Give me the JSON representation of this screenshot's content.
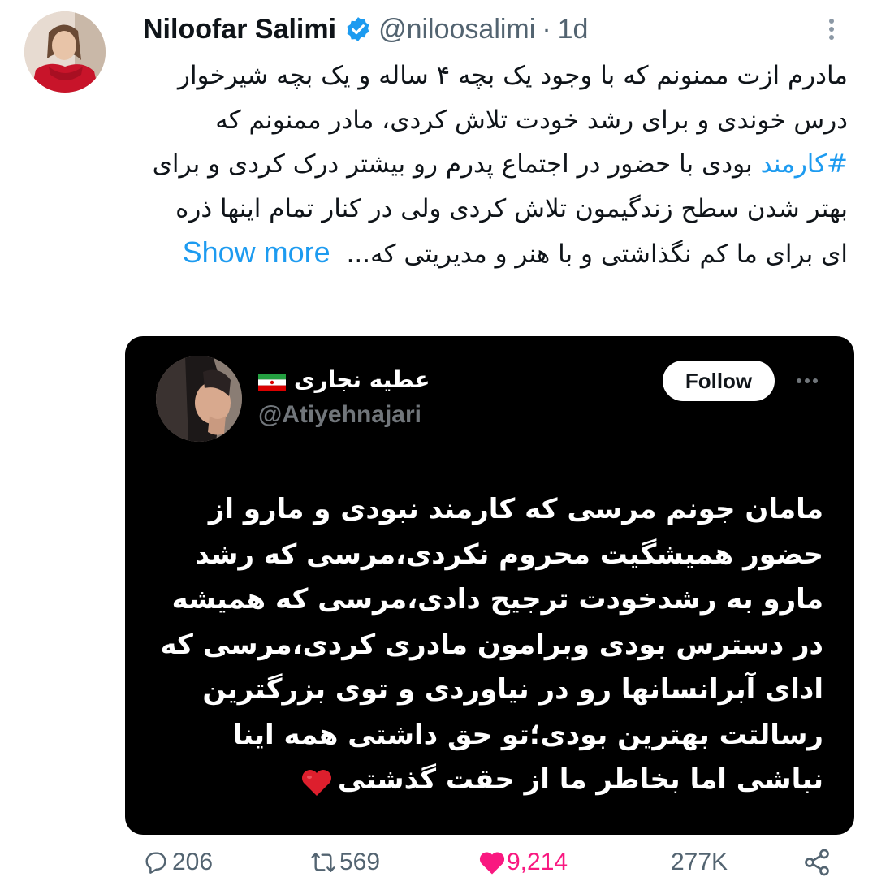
{
  "tweet": {
    "author_name": "Niloofar Salimi",
    "handle": "@niloosalimi",
    "separator": "·",
    "time": "1d",
    "text_part1": "مادرم ازت ممنونم که با وجود یک بچه ۴ ساله و یک بچه شیرخوار درس خوندی و برای رشد خودت تلاش کردی، مادر ممنونم که ",
    "hashtag": "#کارمند",
    "text_part2": " بودی با حضور در اجتماع پدرم رو بیشتر درک کردی و برای بهتر شدن سطح زندگیمون تلاش کردی ولی در کنار تمام اینها ذره ای برای ما کم نگذاشتی و با هنر و مدیریتی که...",
    "show_more": "Show more"
  },
  "quote": {
    "name": "عطیه نجاری",
    "handle": "@Atiyehnajari",
    "follow_label": "Follow",
    "text": "مامان جونم مرسی که کارمند نبودی و مارو از حضور همیشگیت محروم نکردی،مرسی که رشد مارو به رشدخودت ترجیح دادی،مرسی که همیشه در دسترس بودی وبرامون مادری کردی،مرسی که ادای آبرانسانها رو در نیاوردی و توی بزرگترین رسالتت بهترین بودی؛تو حق داشتی همه اینا نباشی اما بخاطر ما از حقت گذشتی"
  },
  "actions": {
    "replies": "206",
    "reposts": "569",
    "likes": "9,214",
    "views": "277K"
  },
  "colors": {
    "accent": "#1d9bf0",
    "like": "#f91880",
    "muted": "#536471",
    "quote_bg": "#000000"
  },
  "icons": [
    "verified-badge-icon",
    "more-options-icon",
    "iran-flag-icon",
    "red-heart-emoji",
    "reply-icon",
    "repost-icon",
    "like-heart-icon",
    "share-icon"
  ]
}
